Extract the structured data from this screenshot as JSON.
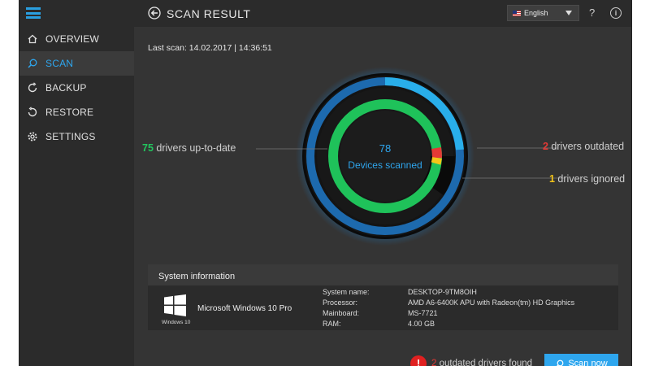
{
  "nav": {
    "items": [
      {
        "label": "OVERVIEW",
        "icon": "home-icon"
      },
      {
        "label": "SCAN",
        "icon": "search-icon"
      },
      {
        "label": "BACKUP",
        "icon": "backup-icon"
      },
      {
        "label": "RESTORE",
        "icon": "restore-icon"
      },
      {
        "label": "SETTINGS",
        "icon": "gear-icon"
      }
    ]
  },
  "header": {
    "title": "SCAN RESULT",
    "language": "English",
    "help": "?",
    "info": "i"
  },
  "scan": {
    "last_scan": "Last scan: 14.02.2017 | 14:36:51",
    "devices_count": "78",
    "devices_label": "Devices scanned",
    "uptodate_count": "75",
    "uptodate_label": " drivers up-to-date",
    "outdated_count": "2",
    "outdated_label": " drivers outdated",
    "ignored_count": "1",
    "ignored_label": " drivers ignored"
  },
  "sysinfo": {
    "title": "System information",
    "os_name": "Microsoft Windows 10 Pro",
    "os_caption": "Windows 10",
    "rows": [
      {
        "key": "System name:",
        "value": "DESKTOP-9TM8OIH"
      },
      {
        "key": "Processor:",
        "value": "AMD A6-6400K APU with Radeon(tm) HD Graphics"
      },
      {
        "key": "Mainboard:",
        "value": "MS-7721"
      },
      {
        "key": "RAM:",
        "value": "4.00 GB"
      }
    ]
  },
  "footer": {
    "alert_icon": "!",
    "outdated_count": "2",
    "outdated_text": " outdated drivers found",
    "scan_button": "Scan now"
  },
  "colors": {
    "accent": "#2ea6ee",
    "green": "#22c55e",
    "red": "#e53935",
    "yellow": "#f5c518"
  }
}
